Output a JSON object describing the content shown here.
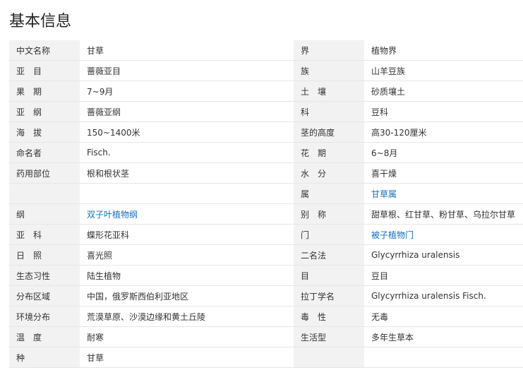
{
  "title": "基本信息",
  "rows": [
    {
      "l1": "中文名称",
      "v1": "甘草",
      "l2": "界",
      "v2": "植物界"
    },
    {
      "l1": "亚　目",
      "v1": "蔷薇亚目",
      "l2": "族",
      "v2": "山羊豆族"
    },
    {
      "l1": "果　期",
      "v1": "7~9月",
      "l2": "土　壤",
      "v2": "砂质壤土"
    },
    {
      "l1": "亚　纲",
      "v1": "蔷薇亚纲",
      "l2": "科",
      "v2": "豆科"
    },
    {
      "l1": "海　拔",
      "v1": "150~1400米",
      "l2": "茎的高度",
      "v2": "高30-120厘米"
    },
    {
      "l1": "命名者",
      "v1": "Fisch.",
      "l2": "花　期",
      "v2": "6~8月"
    },
    {
      "l1": "药用部位",
      "v1": "根和根状茎",
      "l2": "水　分",
      "v2": "喜干燥"
    },
    {
      "l1": "",
      "v1": "",
      "l2": "属",
      "v2": "甘草属"
    },
    {
      "l1": "纲",
      "v1": "双子叶植物纲",
      "l2": "别　称",
      "v2": "甜草根、红甘草、粉甘草、乌拉尔甘草"
    },
    {
      "l1": "亚　科",
      "v1": "蝶形花亚科",
      "l2": "门",
      "v2": "被子植物门"
    },
    {
      "l1": "日　照",
      "v1": "喜光照",
      "l2": "二名法",
      "v2": "Glycyrrhiza uralensis"
    },
    {
      "l1": "生态习性",
      "v1": "陆生植物",
      "l2": "目",
      "v2": "豆目"
    },
    {
      "l1": "分布区域",
      "v1": "中国，俄罗斯西伯利亚地区",
      "l2": "拉丁学名",
      "v2": "Glycyrrhiza uralensis Fisch."
    },
    {
      "l1": "环境分布",
      "v1": "荒漠草原、沙漠边缘和黄土丘陵",
      "l2": "毒　性",
      "v2": "无毒"
    },
    {
      "l1": "温　度",
      "v1": "耐寒",
      "l2": "生活型",
      "v2": "多年生草本"
    },
    {
      "l1": "种",
      "v1": "甘草",
      "l2": "",
      "v2": ""
    }
  ],
  "colors": {
    "label_bg": "#f2f2f2",
    "link": "#136ec2",
    "text": "#333333"
  }
}
